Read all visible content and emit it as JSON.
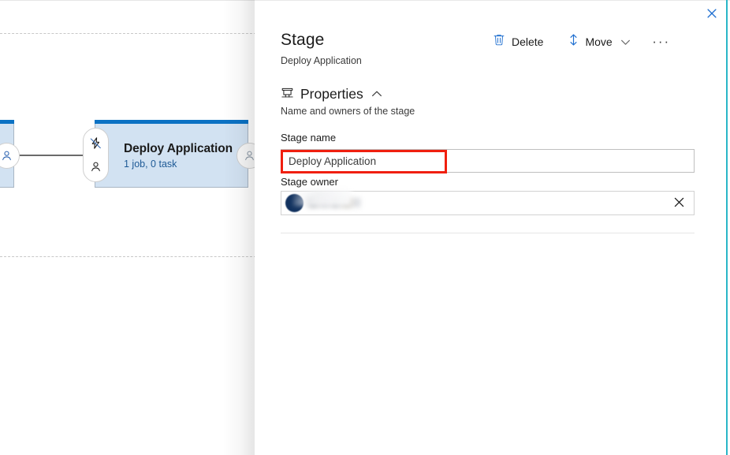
{
  "panel": {
    "title": "Stage",
    "subtitle": "Deploy Application",
    "close_label": "Close",
    "close_icon": "close-icon"
  },
  "command_bar": {
    "delete": {
      "label": "Delete",
      "icon": "trash-icon"
    },
    "move": {
      "label": "Move",
      "icon": "move-updown-icon",
      "chevron": "chevron-down-icon"
    },
    "more": {
      "label": "More options",
      "icon": "ellipsis-icon",
      "glyph": "···"
    }
  },
  "properties_section": {
    "icon": "server-stage-icon",
    "title": "Properties",
    "collapse_icon": "chevron-up-icon",
    "description": "Name and owners of the stage"
  },
  "form": {
    "stage_name": {
      "label": "Stage name",
      "value": "Deploy Application",
      "placeholder": "Stage name"
    },
    "stage_owner": {
      "label": "Stage owner",
      "value": "",
      "redacted": true,
      "avatar_initials": "",
      "clear_icon": "close-icon",
      "clear_label": "Remove stage owner"
    }
  },
  "annotation": {
    "color": "#f01f0f",
    "target": "stage-name-input"
  },
  "canvas": {
    "selected_stage": {
      "title": "Deploy Application",
      "subtitle": "1 job, 0 task",
      "trigger_icon": "lightning-bolt-icon",
      "approval_icon": "person-icon"
    },
    "previous_stage": {
      "approval_icon": "person-icon"
    },
    "next_stage": {
      "approval_icon": "person-icon"
    }
  },
  "theme": {
    "accent": "#0b72c4",
    "stage_fill": "#d2e2f2",
    "link_blue": "#1e5a96",
    "edge_accent": "#29b6c8",
    "annotation_red": "#f01f0f"
  }
}
